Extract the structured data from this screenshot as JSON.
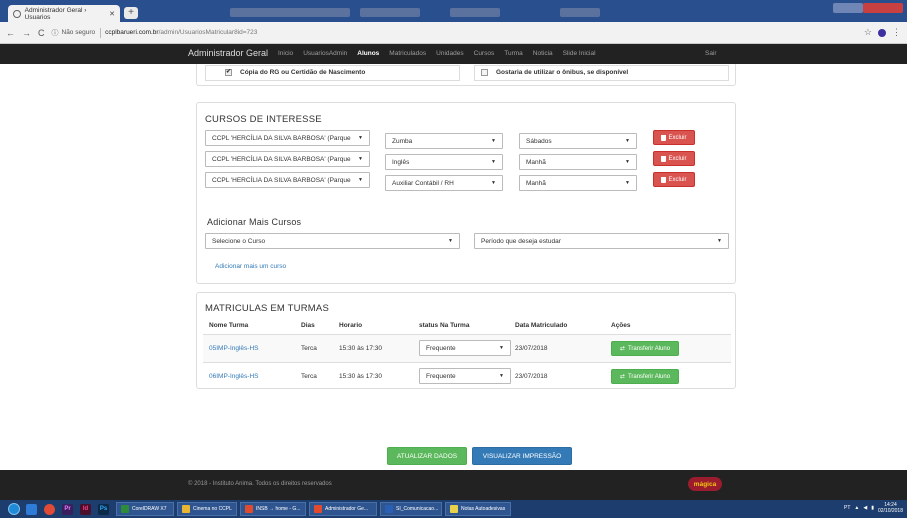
{
  "browser": {
    "tab_title": "Administrador Geral › Usuarios",
    "url_secure_label": "Não seguro",
    "url_host": "ccplbarueri.com.br",
    "url_path": "/admin/UsuariosMatricular8id=723"
  },
  "nav": {
    "brand": "Administrador Geral",
    "links": [
      "Inicio",
      "UsuariosAdmin",
      "Alunos",
      "Matriculados",
      "Unidades",
      "Cursos",
      "Turma",
      "Noticia",
      "Slide Inicial"
    ],
    "active": "Alunos",
    "logout": "Sair"
  },
  "documents": [
    {
      "label": "Cópia do RG ou Certidão de Nascimento",
      "checked": true
    },
    {
      "label": "Gostaria de utilizar o ônibus, se disponível",
      "checked": false
    }
  ],
  "cursos": {
    "title": "CURSOS DE INTERESSE",
    "rows": [
      {
        "unidade": "CCPL 'HERCÍLIA DA SILVA BARBOSA' (Parque",
        "curso": "Zumba",
        "periodo": "Sábados",
        "excluir": "Excluir"
      },
      {
        "unidade": "CCPL 'HERCÍLIA DA SILVA BARBOSA' (Parque",
        "curso": "Inglês",
        "periodo": "Manhã",
        "excluir": "Excluir"
      },
      {
        "unidade": "CCPL 'HERCÍLIA DA SILVA BARBOSA' (Parque",
        "curso": "Auxiliar Contábil / RH",
        "periodo": "Manhã",
        "excluir": "Excluir"
      }
    ],
    "add_title": "Adicionar Mais Cursos",
    "select_curso_placeholder": "Selecione o Curso",
    "select_periodo_placeholder": "Período que deseja estudar",
    "add_link": "Adicionar mais um curso"
  },
  "turmas": {
    "title": "MATRICULAS EM TURMAS",
    "headers": [
      "Nome Turma",
      "Dias",
      "Horario",
      "status Na Turma",
      "Data Matriculado",
      "Ações"
    ],
    "rows": [
      {
        "nome": "05IMP-Inglês-HS",
        "dias": "Terca",
        "horario": "15:30 às 17:30",
        "status": "Frequente",
        "data": "23/07/2018",
        "acao": "Transferir Aluno"
      },
      {
        "nome": "06IMP-Inglês-HS",
        "dias": "Terca",
        "horario": "15:30 às 17:30",
        "status": "Frequente",
        "data": "23/07/2018",
        "acao": "Transferir Aluno"
      }
    ]
  },
  "actions": {
    "atualizar": "ATUALIZAR DADOS",
    "visualizar": "VISUALIZAR IMPRESSÃO"
  },
  "footer": {
    "copyright": "© 2018 - Instituto Anima. Todos os direitos reservados",
    "logo_text": "mágica"
  },
  "taskbar": {
    "tasks": [
      {
        "label": "CorelDRAW X7",
        "color": "#2e8b3a"
      },
      {
        "label": "Cinema no CCPL",
        "color": "#e8b630"
      },
      {
        "label": "INSB → home - G...",
        "color": "#e04a2f"
      },
      {
        "label": "Administrador Ge...",
        "color": "#e04a2f"
      },
      {
        "label": "SI_Comunicacao...",
        "color": "#2b5fb4"
      },
      {
        "label": "Notas Autoadesivas",
        "color": "#e8d24a"
      }
    ],
    "lang": "PT",
    "time": "14:24",
    "date": "02/10/2018"
  }
}
